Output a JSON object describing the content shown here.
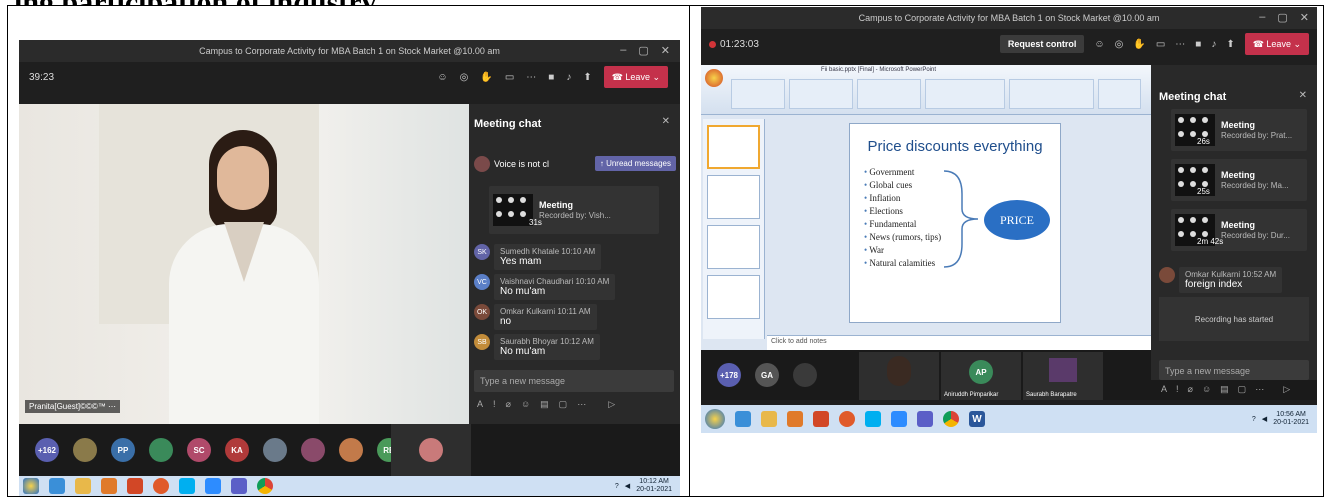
{
  "document": {
    "heading": "ing participation of industry"
  },
  "left_shot": {
    "window_title": "Campus to Corporate Activity for MBA Batch 1 on Stock Market @10.00 am",
    "call_timer": "39:23",
    "leave_label": "Leave",
    "presenter_tag": "Pranita[Guest]©©©™ ⋯",
    "chat": {
      "title": "Meeting chat",
      "voice_snippet": "Voice is not cl",
      "unread_label": "Unread messages",
      "recording": {
        "title": "Meeting",
        "subtitle": "Recorded by: Vish...",
        "duration": "31s"
      },
      "messages": [
        {
          "initials": "SK",
          "color": "#6264a7",
          "sender": "Sumedh Khatale",
          "time": "10:10 AM",
          "text": "Yes mam"
        },
        {
          "initials": "VC",
          "color": "#5b7fc7",
          "sender": "Vaishnavi Chaudhari",
          "time": "10:10 AM",
          "text": "No mu'am"
        },
        {
          "initials": "OK",
          "color": "#7a4a3a",
          "sender": "Omkar Kulkarni",
          "time": "10:11 AM",
          "text": "no"
        },
        {
          "initials": "SB",
          "color": "#c28c3a",
          "sender": "Saurabh Bhoyar",
          "time": "10:12 AM",
          "text": "No mu'am"
        }
      ],
      "type_placeholder": "Type a new message"
    },
    "participants": [
      {
        "label": "+162",
        "color": "#5a5fb0"
      },
      {
        "label": "",
        "color": "#8a7a4a"
      },
      {
        "label": "PP",
        "color": "#3a6fa8"
      },
      {
        "label": "",
        "color": "#3a8a5a"
      },
      {
        "label": "SC",
        "color": "#b04a6a"
      },
      {
        "label": "KA",
        "color": "#b03a3a"
      },
      {
        "label": "",
        "color": "#6a7a8a"
      },
      {
        "label": "",
        "color": "#8a4a6a"
      },
      {
        "label": "",
        "color": "#c27a4a"
      },
      {
        "label": "RB",
        "color": "#4a9a5a"
      }
    ],
    "clock": {
      "time": "10:12 AM",
      "date": "20-01-2021"
    }
  },
  "right_shot": {
    "window_title": "Campus to Corporate Activity for MBA Batch 1 on Stock Market @10.00 am",
    "call_timer": "01:23:03",
    "request_control_label": "Request control",
    "leave_label": "Leave",
    "ppt_title": "Fii basic.pptx [Final] - Microsoft PowerPoint",
    "slide": {
      "title": "Price discounts everything",
      "bullets": [
        "Government",
        "Global cues",
        "Inflation",
        "Elections",
        "Fundamental",
        "News (rumors, tips)",
        "War",
        "Natural calamities"
      ],
      "oval_label": "PRICE",
      "notes_placeholder": "Click to add notes"
    },
    "chat": {
      "title": "Meeting chat",
      "recordings": [
        {
          "title": "Meeting",
          "subtitle": "Recorded by: Prat...",
          "duration": "26s"
        },
        {
          "title": "Meeting",
          "subtitle": "Recorded by: Ma...",
          "duration": "25s"
        },
        {
          "title": "Meeting",
          "subtitle": "Recorded by: Dur...",
          "duration": "2m 42s"
        }
      ],
      "message": {
        "sender": "Omkar Kulkarni",
        "time": "10:52 AM",
        "text": "foreign index"
      },
      "recording_started": "Recording has started",
      "type_placeholder": "Type a new message"
    },
    "participants": [
      {
        "label": "+178",
        "color": "#5a5fb0"
      },
      {
        "label": "GA",
        "color": "#555"
      },
      {
        "label": "",
        "color": "#3a3a3a"
      }
    ],
    "tiles": [
      {
        "name": "",
        "initials": ""
      },
      {
        "name": "Aniruddh Pimparikar",
        "initials": "AP"
      },
      {
        "name": "Saurabh Barapatre",
        "initials": ""
      }
    ],
    "clock": {
      "time": "10:56 AM",
      "date": "20-01-2021"
    }
  }
}
